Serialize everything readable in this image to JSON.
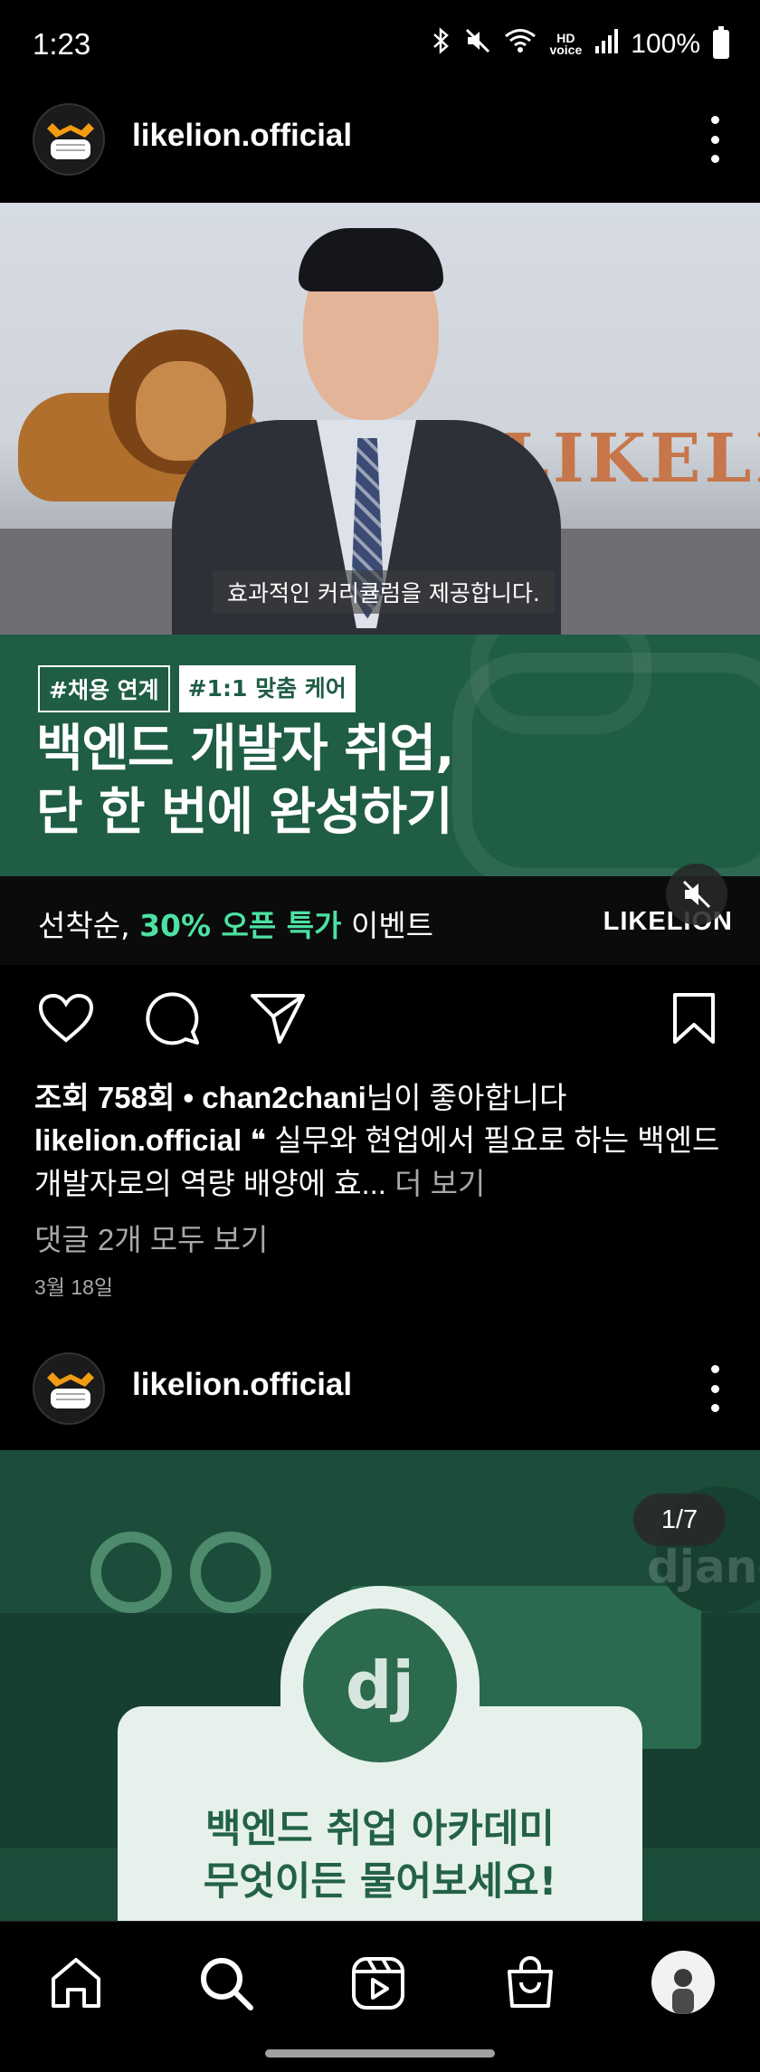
{
  "status_bar": {
    "time": "1:23",
    "hd_top": "HD",
    "hd_bottom": "voice",
    "battery": "100%"
  },
  "post1": {
    "username": "likelion.official",
    "video": {
      "wall_text": "LIKELIO",
      "subtitle": "효과적인 커리큘럼을 제공합니다."
    },
    "banner": {
      "tag1": "#채용 연계",
      "tag2": "#1:1 맞춤 케어",
      "headline_line1": "백엔드 개발자 취업,",
      "headline_line2": "단 한 번에 완성하기",
      "promo_prefix": "선착순, ",
      "promo_highlight": "30% 오픈 특가",
      "promo_suffix": " 이벤트",
      "brand": "LIKELION"
    },
    "views_prefix": "조회 758회 • ",
    "liked_by": "chan2chani",
    "liked_suffix": "님이 좋아합니다",
    "caption_user": "likelion.official",
    "caption_text": " ❝ 실무와 현업에서 필요로 하는 백엔드 개발자로의 역량 배양에 효...",
    "caption_more": " 더 보기",
    "comments_link": "댓글 2개 모두 보기",
    "date": "3월 18일"
  },
  "post2": {
    "username": "likelion.official",
    "counter": "1/7",
    "dj_logo": "dj",
    "django_text": "django",
    "card_line1": "백엔드 취업 아카데미",
    "card_line2": "무엇이든 물어보세요!"
  },
  "bottom_nav": {
    "items": [
      "home-icon",
      "search-icon",
      "reels-icon",
      "shop-icon",
      "profile-avatar"
    ]
  },
  "colors": {
    "banner_green": "#1f5d44",
    "promo_highlight": "#4ce1a2",
    "card_text": "#236246"
  }
}
